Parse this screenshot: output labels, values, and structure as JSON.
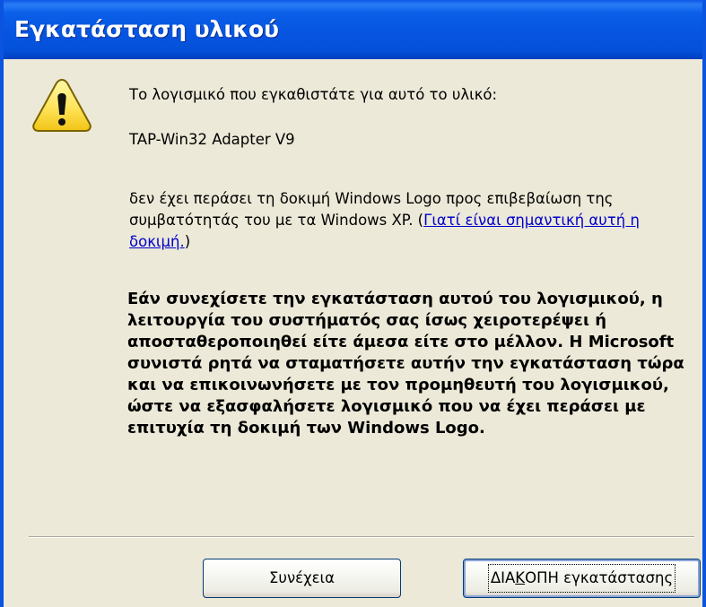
{
  "window": {
    "title": "Εγκατάσταση υλικού"
  },
  "icons": {
    "warning": "warning-icon"
  },
  "message": {
    "intro": "Το λογισμικό που εγκαθιστάτε για αυτό το υλικό:",
    "device_name": "TAP-Win32 Adapter V9",
    "not_passed_text": "δεν έχει περάσει τη δοκιμή Windows Logo προς επιβεβαίωση της συμβατότητάς του με τα Windows XP. (",
    "link_text": "Γιατί είναι σημαντική αυτή η δοκιμή.",
    "not_passed_end": ")",
    "warning_bold": "Εάν συνεχίσετε την εγκατάσταση αυτού του λογισμικού, η λειτουργία του συστήματός σας ίσως χειροτερέψει ή αποσταθεροποιηθεί είτε άμεσα είτε στο μέλλον. Η Microsoft συνιστά ρητά να σταματήσετε αυτήν την εγκατάσταση τώρα και να επικοινωνήσετε με τον προμηθευτή του λογισμικού, ώστε να εξασφαλήσετε λογισμικό που να έχει περάσει με επιτυχία τη δοκιμή των Windows Logo."
  },
  "buttons": {
    "continue_pre": "Συνέ",
    "continue_mnemonic": "χ",
    "continue_post": "εια",
    "stop_pre": "ΔΙΑ",
    "stop_mnemonic": "Κ",
    "stop_post": "ΟΠΗ εγκατάστασης"
  }
}
